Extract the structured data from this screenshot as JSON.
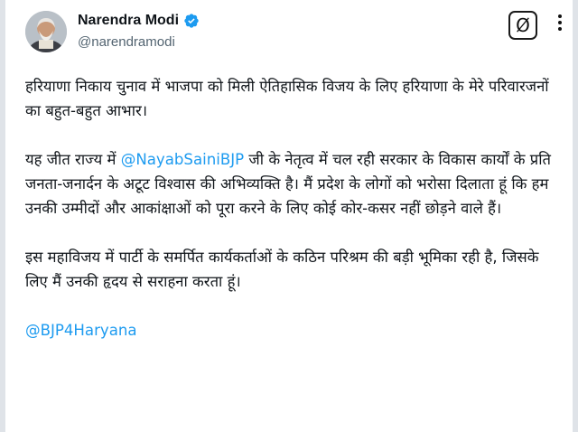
{
  "author": {
    "name": "Narendra Modi",
    "handle": "@narendramodi",
    "verified": true,
    "verified_color": "#1d9bf0"
  },
  "toolbar": {
    "filter_icon": "Ø"
  },
  "post": {
    "p1": "हरियाणा निकाय चुनाव में भाजपा को मिली ऐतिहासिक विजय के लिए हरियाणा के मेरे परिवारजनों का बहुत-बहुत आभार।",
    "p2_before": "यह जीत राज्य में ",
    "p2_mention": "@NayabSainiBJP",
    "p2_after": " जी के नेतृत्व में चल रही सरकार के विकास कार्यों के प्रति जनता-जनार्दन के अटूट विश्वास की अभिव्यक्ति है। मैं प्रदेश के लोगों को भरोसा दिलाता हूं कि हम उनकी उम्मीदों और आकांक्षाओं को पूरा करने के लिए कोई कोर-कसर नहीं छोड़ने वाले हैं।",
    "p3": "इस महाविजय में पार्टी के समर्पित कार्यकर्ताओं के कठिन परिश्रम की बड़ी भूमिका रही है, जिसके लिए मैं उनकी हृदय से सराहना करता हूं।",
    "p4_mention": "@BJP4Haryana",
    "mention_color": "#1d9bf0"
  }
}
